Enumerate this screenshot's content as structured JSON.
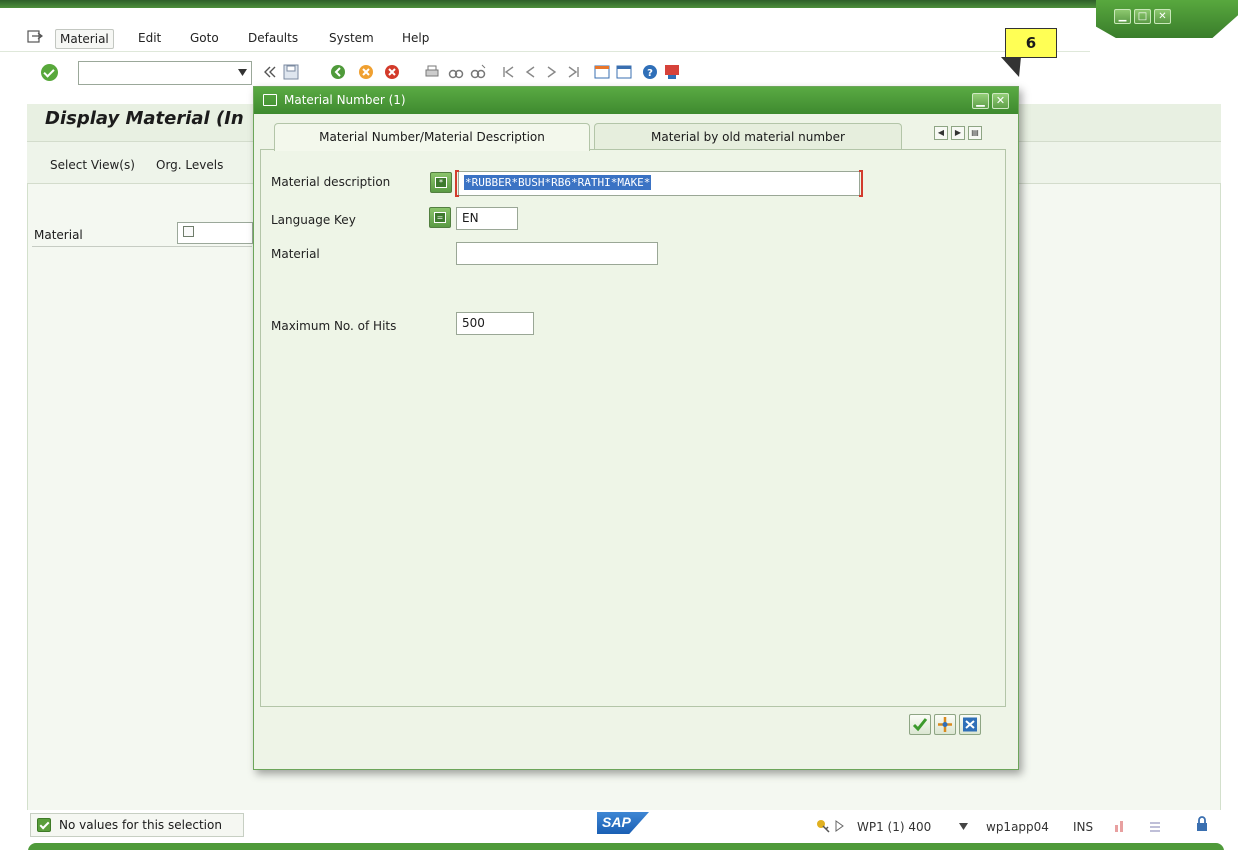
{
  "menubar": {
    "items": [
      "Material",
      "Edit",
      "Goto",
      "Defaults",
      "System",
      "Help"
    ]
  },
  "main": {
    "title": "Display Material (In",
    "app_toolbar": [
      "Select View(s)",
      "Org. Levels"
    ],
    "material_label": "Material"
  },
  "dialog": {
    "title": "Material Number (1)",
    "tabs": [
      "Material Number/Material Description",
      "Material by old material number"
    ],
    "fields": {
      "material_description_label": "Material description",
      "material_description_value": "*RUBBER*BUSH*RB6*RATHI*MAKE*",
      "language_key_label": "Language Key",
      "language_key_value": "EN",
      "material_label": "Material",
      "material_value": "",
      "max_hits_label": "Maximum No. of Hits",
      "max_hits_value": "500"
    }
  },
  "callout": {
    "number": "6"
  },
  "statusbar": {
    "message": "No values for this selection",
    "logo": "SAP",
    "system": "WP1 (1) 400",
    "server": "wp1app04",
    "mode": "INS"
  },
  "colors": {
    "sap_green": "#4f9a3a",
    "selection_blue": "#3b73c4",
    "required_red": "#d23b2d",
    "callout_yellow": "#ffff55"
  }
}
